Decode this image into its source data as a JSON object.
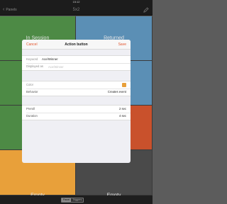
{
  "status_bar": {
    "time": "15:12"
  },
  "nav": {
    "back_label": "Panels",
    "title": "5x2"
  },
  "tiles": [
    {
      "label": "In Session",
      "color": "#4d8a45"
    },
    {
      "label": "Returned",
      "color": "#5b8fb5"
    },
    {
      "label": "",
      "color": "#4d8a45"
    },
    {
      "label": "",
      "color": "#5b8fb5"
    },
    {
      "label": "",
      "color": "#4d8a45"
    },
    {
      "label": "",
      "color": "#c9512c"
    },
    {
      "label": "",
      "color": "#e8a03a"
    },
    {
      "label": "",
      "color": "#4a4a4a"
    },
    {
      "label": "Empty",
      "color": "#4a4a4a"
    },
    {
      "label": "Empty",
      "color": "#4a4a4a"
    }
  ],
  "toolbar": {
    "segments": [
      "Panel",
      "Triggers"
    ]
  },
  "modal": {
    "cancel_label": "Cancel",
    "title": "Action button",
    "save_label": "Save",
    "keyword_label": "Keyword",
    "keyword_value": "Ace/Winner",
    "displayed_as_label": "Displayed as",
    "displayed_as_placeholder": "Ace/Winner",
    "color_label": "Color",
    "color_value": "#e8a03a",
    "behavior_label": "Behavior",
    "behavior_value": "Creates event",
    "preroll_label": "Preroll",
    "preroll_value": "2 sec",
    "duration_label": "Duration",
    "duration_value": "4 sec"
  }
}
